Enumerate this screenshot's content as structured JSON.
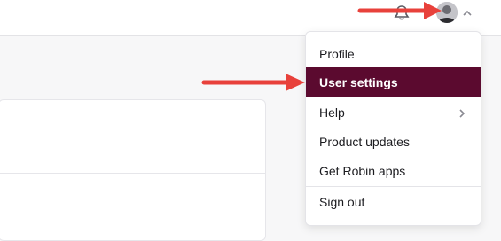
{
  "header": {
    "icons": [
      "bell-icon",
      "avatar",
      "chevron-up-icon"
    ]
  },
  "user_menu": {
    "items": [
      {
        "label": "Profile"
      },
      {
        "label": "User settings",
        "active": true
      },
      {
        "label": "Help",
        "has_submenu": true
      },
      {
        "label": "Product updates"
      },
      {
        "label": "Get Robin apps"
      },
      {
        "label": "Sign out"
      }
    ]
  },
  "colors": {
    "active_item_bg": "#5b0a2f",
    "annotation_arrow": "#e8413b"
  }
}
